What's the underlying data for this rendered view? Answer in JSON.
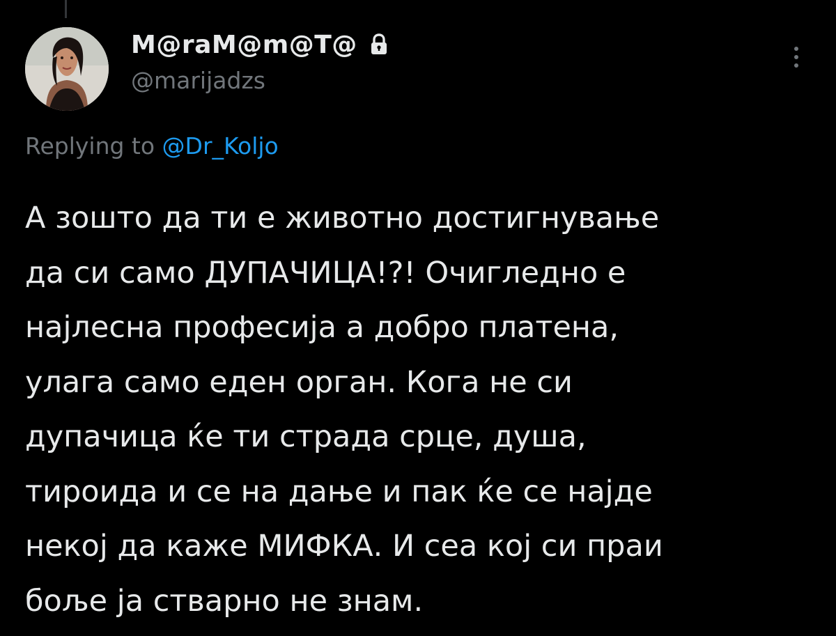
{
  "tweet": {
    "author": {
      "display_name": "M@raM@m@T@",
      "handle": "@marijadzs",
      "protected_icon": "lock-icon",
      "avatar_icon": "avatar"
    },
    "more_icon": "more-vertical-icon",
    "reply": {
      "prefix": "Replying to",
      "mention": "@Dr_Koljo"
    },
    "text_lines": [
      "А зошто да ти е животно достигнување",
      "да си само ДУПАЧИЦА!?! Очигледно е",
      "најлесна професија а добро платена,",
      "улага само еден орган. Кога не си",
      "дупачица ќе ти страда срце, душа,",
      "тироида и се на дање и пак ќе се најде",
      "некој да каже МИФКА. И сеа кој си праи",
      "боље ја стварно не знам."
    ]
  },
  "colors": {
    "background": "#000000",
    "primary_text": "#e7e9ea",
    "secondary_text": "#71767b",
    "link": "#1d9bf0",
    "thread_line": "#333639"
  }
}
